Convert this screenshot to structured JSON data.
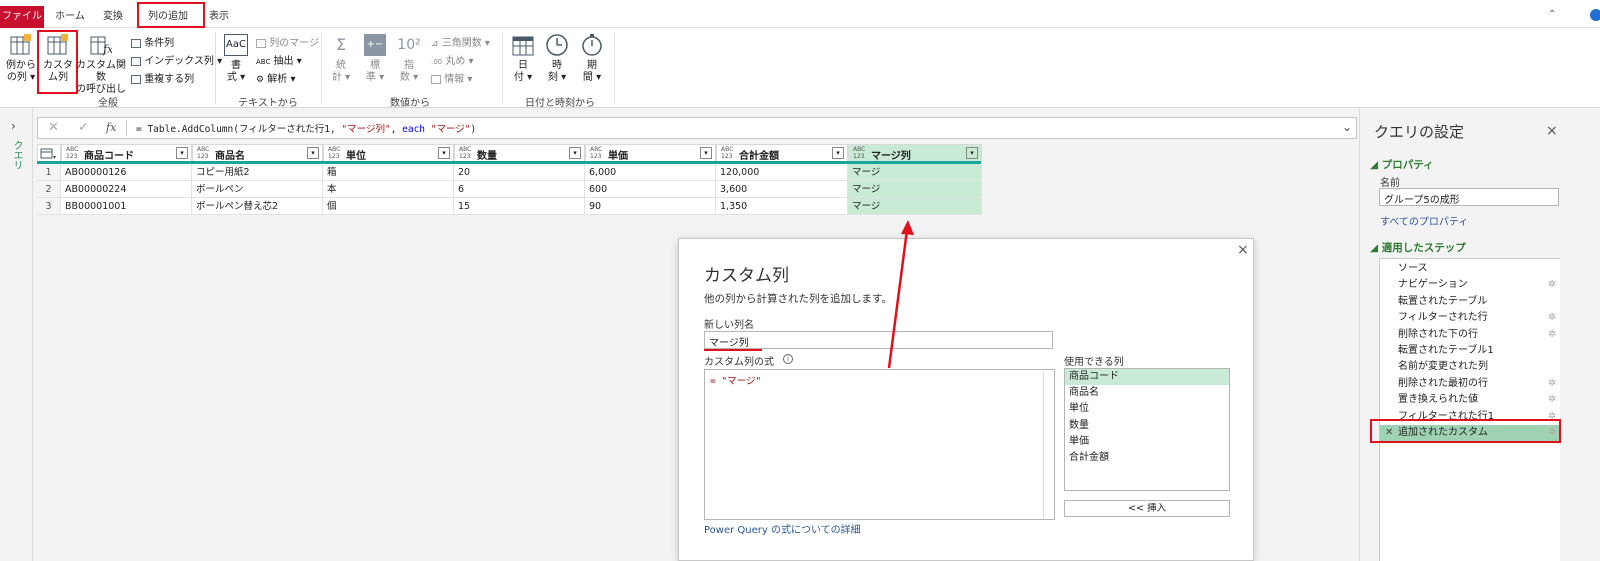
{
  "tabs": [
    "ファイル",
    "ホーム",
    "変換",
    "列の追加",
    "表示"
  ],
  "ribbon": {
    "groups": {
      "general": "全般",
      "text": "テキストから",
      "number": "数値から",
      "date": "日付と時刻から"
    },
    "example_col": [
      "例から",
      "の列 ▾"
    ],
    "custom_col": [
      "カスタ",
      "ム列"
    ],
    "custom_func": [
      "カスタム関数",
      "の呼び出し"
    ],
    "conditional_col": "条件列",
    "index_col": "インデックス列 ▾",
    "duplicate_col": "重複する列",
    "format": [
      "書",
      "式 ▾"
    ],
    "merge_cols": "列のマージ",
    "extract": "抽出 ▾",
    "parse": "解析 ▾",
    "statistics": [
      "統",
      "計 ▾"
    ],
    "standard": [
      "標",
      "準 ▾"
    ],
    "scientific": [
      "指",
      "数 ▾"
    ],
    "trig": "三角関数 ▾",
    "rounding": "丸め ▾",
    "information": "情報 ▾",
    "date": [
      "日",
      "付 ▾"
    ],
    "time": [
      "時",
      "刻 ▾"
    ],
    "duration": [
      "期",
      "間 ▾"
    ]
  },
  "query_pane_label": "クエリ",
  "formula": {
    "fx": "fx",
    "prefix": "= Table.AddColumn(フィルターされた行1, ",
    "str1": "\"マージ列\"",
    "mid": ", ",
    "kw": "each",
    "str2": " \"マージ\"",
    "suffix": ")"
  },
  "table": {
    "type_label": "ABC\n123",
    "columns": [
      "商品コード",
      "商品名",
      "単位",
      "数量",
      "単価",
      "合計金額",
      "マージ列"
    ],
    "rows": [
      [
        "1",
        "AB00000126",
        "コピー用紙2",
        "箱",
        "20",
        "6,000",
        "120,000",
        "マージ"
      ],
      [
        "2",
        "AB00000224",
        "ボールペン",
        "本",
        "6",
        "600",
        "3,600",
        "マージ"
      ],
      [
        "3",
        "BB00001001",
        "ボールペン替え芯2",
        "個",
        "15",
        "90",
        "1,350",
        "マージ"
      ]
    ]
  },
  "dialog": {
    "title": "カスタム列",
    "description": "他の列から計算された列を追加します。",
    "name_label": "新しい列名",
    "name_value": "マージ列",
    "formula_label": "カスタム列の式",
    "formula_value": "= \"マージ\"",
    "available_label": "使用できる列",
    "available": [
      "商品コード",
      "商品名",
      "単位",
      "数量",
      "単価",
      "合計金額"
    ],
    "insert": "<< 挿入",
    "link": "Power Query の式についての詳細"
  },
  "settings": {
    "title": "クエリの設定",
    "properties": "プロパティ",
    "name_label": "名前",
    "name_value": "グループ5の成形",
    "all_props": "すべてのプロパティ",
    "applied_steps": "適用したステップ",
    "steps": [
      "ソース",
      "ナビゲーション",
      "転置されたテーブル",
      "フィルターされた行",
      "削除された下の行",
      "転置されたテーブル1",
      "名前が変更された列",
      "削除された最初の行",
      "置き換えられた値",
      "フィルターされた行1",
      "追加されたカスタム"
    ],
    "steps_gear": [
      false,
      true,
      false,
      true,
      true,
      false,
      false,
      true,
      true,
      true,
      true
    ]
  },
  "colors": {
    "accent_red": "#e0101c",
    "file_tab": "#c8102e",
    "selected_green": "#c9ebd5",
    "teal_bar": "#1aa59a",
    "link_blue": "#2b579a"
  }
}
